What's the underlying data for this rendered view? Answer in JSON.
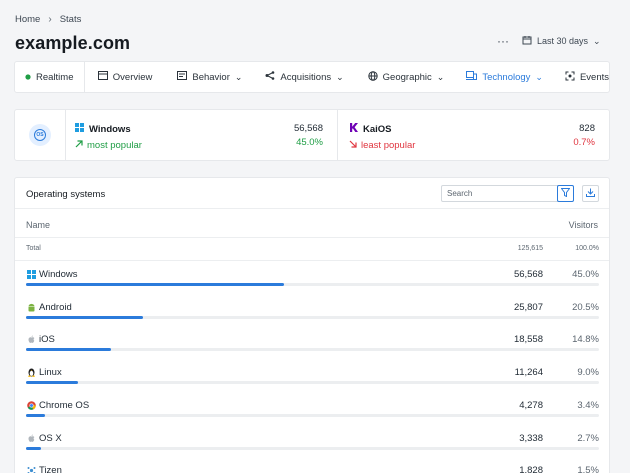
{
  "breadcrumb": {
    "home": "Home",
    "current": "Stats"
  },
  "page": {
    "title": "example.com"
  },
  "header": {
    "more_label": "···",
    "date_range": "Last 30 days"
  },
  "tabs": [
    {
      "label": "Realtime",
      "icon": "green-dot-icon"
    },
    {
      "label": "Overview",
      "icon": "overview-icon"
    },
    {
      "label": "Behavior",
      "icon": "behavior-icon"
    },
    {
      "label": "Acquisitions",
      "icon": "acquisitions-icon"
    },
    {
      "label": "Geographic",
      "icon": "globe-icon"
    },
    {
      "label": "Technology",
      "icon": "technology-icon",
      "active": true
    },
    {
      "label": "Events",
      "icon": "events-icon"
    }
  ],
  "summary": {
    "most": {
      "name": "Windows",
      "tag": "most popular",
      "visitors": "56,568",
      "percent": "45.0%"
    },
    "least": {
      "name": "KaiOS",
      "tag": "least popular",
      "visitors": "828",
      "percent": "0.7%"
    }
  },
  "table": {
    "title": "Operating systems",
    "search_placeholder": "Search",
    "col_name": "Name",
    "col_visitors": "Visitors",
    "total": {
      "label": "Total",
      "visitors": "125,615",
      "percent": "100.0%"
    },
    "rows": [
      {
        "name": "Windows",
        "visitors": "56,568",
        "percent": "45.0%",
        "share": 0.45,
        "icon": "windows-icon"
      },
      {
        "name": "Android",
        "visitors": "25,807",
        "percent": "20.5%",
        "share": 0.205,
        "icon": "android-icon"
      },
      {
        "name": "iOS",
        "visitors": "18,558",
        "percent": "14.8%",
        "share": 0.148,
        "icon": "apple-icon"
      },
      {
        "name": "Linux",
        "visitors": "11,264",
        "percent": "9.0%",
        "share": 0.09,
        "icon": "linux-icon"
      },
      {
        "name": "Chrome OS",
        "visitors": "4,278",
        "percent": "3.4%",
        "share": 0.034,
        "icon": "chrome-icon"
      },
      {
        "name": "OS X",
        "visitors": "3,338",
        "percent": "2.7%",
        "share": 0.027,
        "icon": "apple-icon"
      },
      {
        "name": "Tizen",
        "visitors": "1,828",
        "percent": "1.5%",
        "share": 0.015,
        "icon": "tizen-icon"
      }
    ]
  },
  "colors": {
    "accent": "#2b7bdb",
    "positive": "#1f9d45",
    "negative": "#e0353f"
  }
}
